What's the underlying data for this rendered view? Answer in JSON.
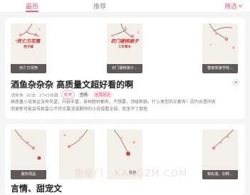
{
  "tabs": {
    "hot": "最热",
    "recommend": "推荐",
    "filter": "筛选"
  },
  "card1": {
    "covers": [
      {
        "art_title": "死亡万花筒",
        "art_sub": "西子绪",
        "caption": "死亡万花筒"
      },
      {
        "art_title": "农门硬核娘子",
        "art_sub": "三年青木",
        "caption": "农门硬核娘子..."
      },
      {
        "art_title": "",
        "art_sub": "",
        "caption": "替彼岸渡学校..."
      }
    ],
    "title": "酒鱼杂杂杂 高质量文超好看的啊",
    "author": "洒鱼鱼",
    "count": "80本",
    "saves": "3745收藏",
    "tags": [
      "耽美",
      "言情",
      "信我别走"
    ],
    "description": "高质量小说保证没有失望，内容丰富，各种题材都有，不想要，顶级新娘。什么类型的文都有！因为总是同名而更新可能会导致雷😊不符合要求或删除的小说或看全部。我坚不了那些"
  },
  "card2": {
    "covers": [
      {
        "caption": "服务周品"
      },
      {
        "caption": ""
      },
      {
        "caption": "我变"
      },
      {
        "caption": "我失落，别啊..."
      }
    ],
    "title": "言情、甜宠文"
  },
  "watermark": "唐掌门 · KANGZM.COM",
  "colors": {
    "accent": "#e0607e"
  }
}
